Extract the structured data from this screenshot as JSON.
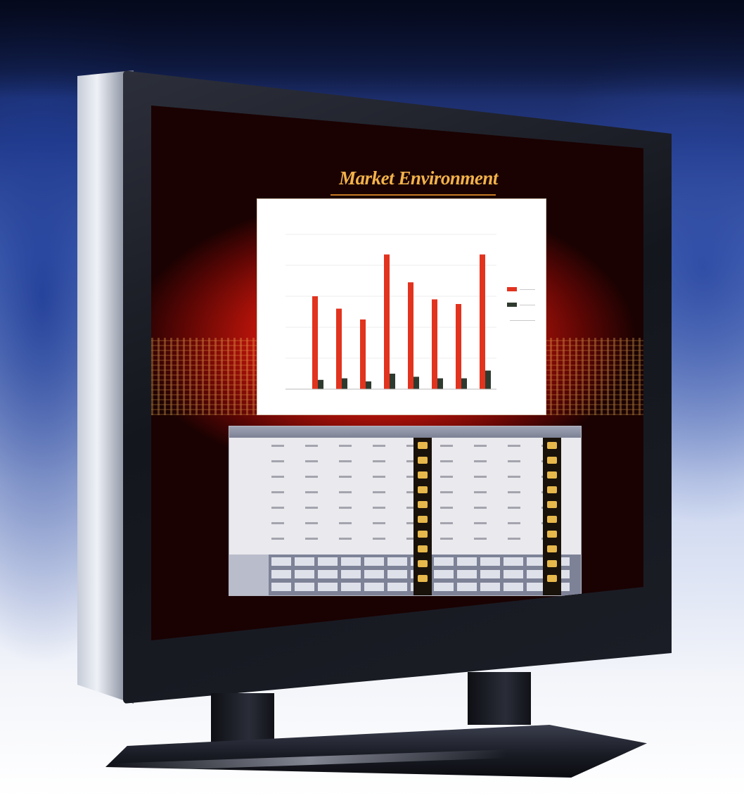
{
  "screen": {
    "title": "Market Environment"
  },
  "chart": {
    "bar_color": "#e2331f",
    "secondary_bar_color": "#2f3a2e",
    "bars_relative_height": [
      0.6,
      0.52,
      0.45,
      0.87,
      0.69,
      0.58,
      0.55,
      0.87
    ],
    "secondary_relative_height": [
      0.06,
      0.07,
      0.05,
      0.1,
      0.08,
      0.07,
      0.07,
      0.12
    ]
  },
  "colors": {
    "screen_glow": "#ff3a1a",
    "title_color": "#f3b24a",
    "table_accent": "#e7b84b"
  }
}
